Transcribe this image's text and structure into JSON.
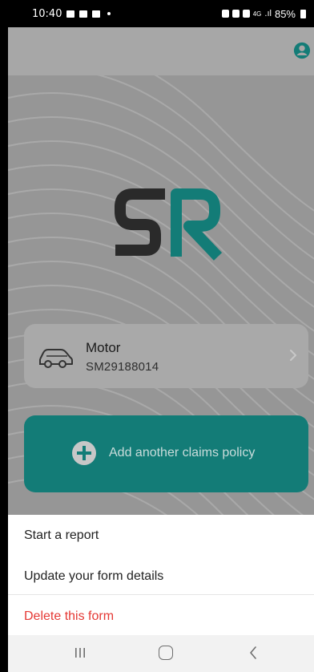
{
  "status_bar": {
    "time": "10:40",
    "battery": "85%",
    "signal_label": "4G"
  },
  "app_bar": {
    "account_icon": "account-circle-icon"
  },
  "logo": {
    "text": "SR",
    "colors": {
      "s": "#2a2a2a",
      "r": "#137c77"
    }
  },
  "policy": {
    "type": "Motor",
    "number": "SM29188014",
    "icon": "car-icon"
  },
  "add_policy": {
    "label": "Add another claims policy",
    "icon": "plus-circle-icon"
  },
  "sheet": {
    "items": [
      {
        "label": "Start a report"
      },
      {
        "label": "Update your form details"
      },
      {
        "label": "Delete this form"
      }
    ]
  },
  "nav": {
    "recents": "recents-icon",
    "home": "home-icon",
    "back": "back-icon"
  },
  "colors": {
    "accent": "#137c77",
    "danger": "#e53935"
  }
}
